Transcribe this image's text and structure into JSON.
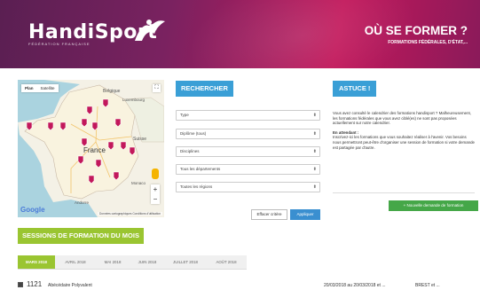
{
  "header": {
    "logo_text": "HandiSport",
    "logo_subtitle": "Fédération française",
    "title": "OÙ SE FORMER ?",
    "subtitle": "FORMATIONS FÉDÉRALES, D'ÉTAT,..."
  },
  "map": {
    "tabs": [
      "Plan",
      "Satellite"
    ],
    "active_tab": "Plan",
    "labels": {
      "belgique": "Belgique",
      "luxembourg": "Luxembourg",
      "france": "France",
      "suisse": "Suisse",
      "monaco": "Monaco",
      "andorre": "Andorre"
    },
    "google": "Google",
    "attribution": "Données cartographiques    Conditions d'utilisation",
    "zoom_in": "+",
    "zoom_out": "−",
    "fullscreen": "⛶"
  },
  "search": {
    "title": "RECHERCHER",
    "fields": [
      {
        "label": "Type"
      },
      {
        "label": "Diplôme (tous)"
      },
      {
        "label": "Disciplines"
      },
      {
        "label": "Tous les départements"
      },
      {
        "label": "Toutes les régions"
      }
    ],
    "reset_label": "Effacer critère",
    "apply_label": "Appliquer"
  },
  "tip": {
    "title": "ASTUCE !",
    "p1": "Vous avez consulté le calendrier des formations handisport ? Malheureusement, les formations fédérales que vous avez ciblé(es) ne sont pas proposées actuellement sur notre calendrier.",
    "p2_head": "En attendant :",
    "p2": "Inscrivez-ici les formations que vous souhaitez réaliser à l'avenir. Vos besoins nous permettront peut-être d'organiser une session de formation si votre demande est partagée par d'autre.",
    "new_request_label": "+ Nouvelle demande de formation"
  },
  "sessions": {
    "title": "SESSIONS DE FORMATION DU MOIS",
    "months": [
      "MARS 2018",
      "AVRIL 2018",
      "MAI 2018",
      "JUIN 2018",
      "JUILLET 2018",
      "AOÛT 2018"
    ],
    "active_month": "MARS 2018",
    "first_row": {
      "number": "1121",
      "name": "Abécédaire Polyvalent",
      "dates": "20/03/2018 au 20/03/2018 et ...",
      "place": "BREST et ..."
    }
  },
  "colors": {
    "header_purple": "#7a2260",
    "header_magenta": "#c2185b",
    "accent_blue": "#3a9fd6",
    "accent_green": "#9ac531",
    "button_green": "#45a748",
    "map_marker": "#c2185b"
  }
}
